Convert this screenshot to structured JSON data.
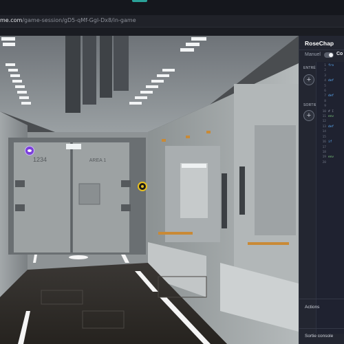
{
  "browser": {
    "url_domain": "me.com",
    "url_path": "/game-session/gD5-qMf-Ggl-Dx8/in-game"
  },
  "scene": {
    "door_left_label": "1234",
    "door_right_label": "AREA 1"
  },
  "panel": {
    "title": "RoseChap",
    "mode_left": "Manuel",
    "mode_right": "Co",
    "input_label": "ENTRÉE",
    "output_label": "SORTIE",
    "add_symbol": "+",
    "line_numbers": "1\n2\n3\n4\n5\n6\n7\n8\n9\n10\n11\n12\n13\n14\n15\n16\n17\n18\n19\n20",
    "code_lines": [
      {
        "cls": "tok-kw",
        "text": "fro"
      },
      {
        "cls": "",
        "text": ""
      },
      {
        "cls": "",
        "text": ""
      },
      {
        "cls": "tok-kw",
        "text": "def"
      },
      {
        "cls": "",
        "text": ""
      },
      {
        "cls": "",
        "text": ""
      },
      {
        "cls": "tok-kw",
        "text": "def"
      },
      {
        "cls": "",
        "text": ""
      },
      {
        "cls": "",
        "text": ""
      },
      {
        "cls": "tok-cm",
        "text": "# I"
      },
      {
        "cls": "tok-str",
        "text": "env"
      },
      {
        "cls": "",
        "text": ""
      },
      {
        "cls": "tok-kw",
        "text": "def"
      },
      {
        "cls": "",
        "text": ""
      },
      {
        "cls": "",
        "text": ""
      },
      {
        "cls": "tok-kw",
        "text": "if"
      },
      {
        "cls": "",
        "text": ""
      },
      {
        "cls": "",
        "text": ""
      },
      {
        "cls": "tok-str",
        "text": "env"
      },
      {
        "cls": "",
        "text": ""
      }
    ],
    "actions_label": "Actions",
    "console_label": "Sortie console"
  },
  "colors": {
    "accent": "#2aa198",
    "warning_light": "#e8c020",
    "status_purple": "#7a3fd8"
  }
}
